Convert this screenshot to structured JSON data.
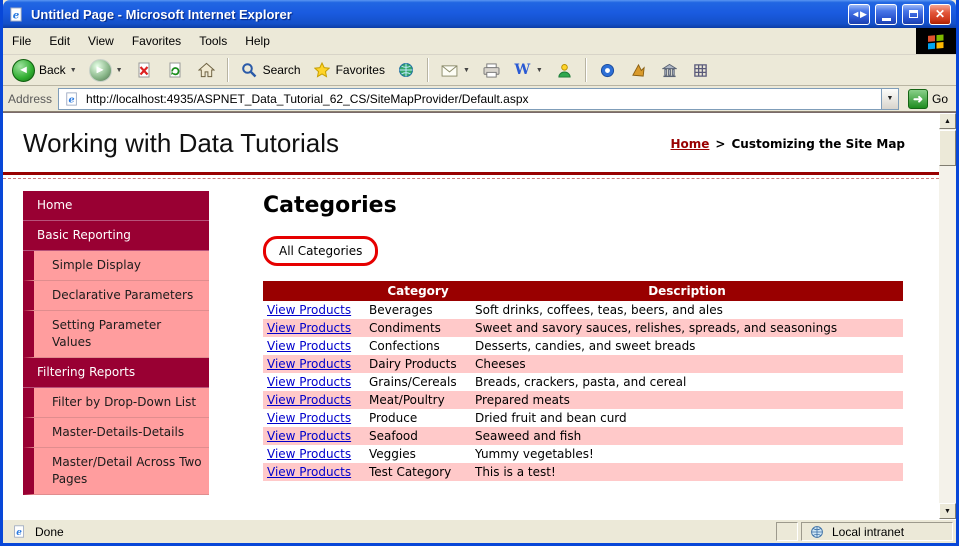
{
  "window": {
    "title": "Untitled Page - Microsoft Internet Explorer"
  },
  "menu_bar": {
    "items": [
      "File",
      "Edit",
      "View",
      "Favorites",
      "Tools",
      "Help"
    ]
  },
  "toolbar": {
    "back": "Back",
    "search": "Search",
    "favorites": "Favorites"
  },
  "address_bar": {
    "label": "Address",
    "url": "http://localhost:4935/ASPNET_Data_Tutorial_62_CS/SiteMapProvider/Default.aspx",
    "go": "Go"
  },
  "page": {
    "title": "Working with Data Tutorials",
    "breadcrumb": {
      "home": "Home",
      "separator": ">",
      "current": "Customizing the Site Map"
    },
    "sidebar": [
      {
        "label": "Home",
        "type": "section"
      },
      {
        "label": "Basic Reporting",
        "type": "section"
      },
      {
        "label": "Simple Display",
        "type": "sub"
      },
      {
        "label": "Declarative Parameters",
        "type": "sub"
      },
      {
        "label": "Setting Parameter Values",
        "type": "sub"
      },
      {
        "label": "Filtering Reports",
        "type": "section"
      },
      {
        "label": "Filter by Drop-Down List",
        "type": "sub"
      },
      {
        "label": "Master-Details-Details",
        "type": "sub"
      },
      {
        "label": "Master/Detail Across Two Pages",
        "type": "sub"
      }
    ],
    "content": {
      "heading": "Categories",
      "filter_label": "All Categories",
      "table": {
        "col_category": "Category",
        "col_description": "Description",
        "link": "View Products",
        "rows": [
          {
            "category": "Beverages",
            "description": "Soft drinks, coffees, teas, beers, and ales"
          },
          {
            "category": "Condiments",
            "description": "Sweet and savory sauces, relishes, spreads, and seasonings"
          },
          {
            "category": "Confections",
            "description": "Desserts, candies, and sweet breads"
          },
          {
            "category": "Dairy Products",
            "description": "Cheeses"
          },
          {
            "category": "Grains/Cereals",
            "description": "Breads, crackers, pasta, and cereal"
          },
          {
            "category": "Meat/Poultry",
            "description": "Prepared meats"
          },
          {
            "category": "Produce",
            "description": "Dried fruit and bean curd"
          },
          {
            "category": "Seafood",
            "description": "Seaweed and fish"
          },
          {
            "category": "Veggies",
            "description": "Yummy vegetables!"
          },
          {
            "category": "Test Category",
            "description": "This is a test!"
          }
        ]
      }
    }
  },
  "status_bar": {
    "done": "Done",
    "zone": "Local intranet"
  },
  "colors": {
    "maroon_header": "#990000",
    "nav_section": "#990033",
    "nav_sub_pink": "#FF9D9E",
    "row_pink": "#FFC9C9",
    "link_blue": "#0000CC",
    "annotation_red": "#E60000",
    "titlebar_blue": "#1450C8"
  }
}
